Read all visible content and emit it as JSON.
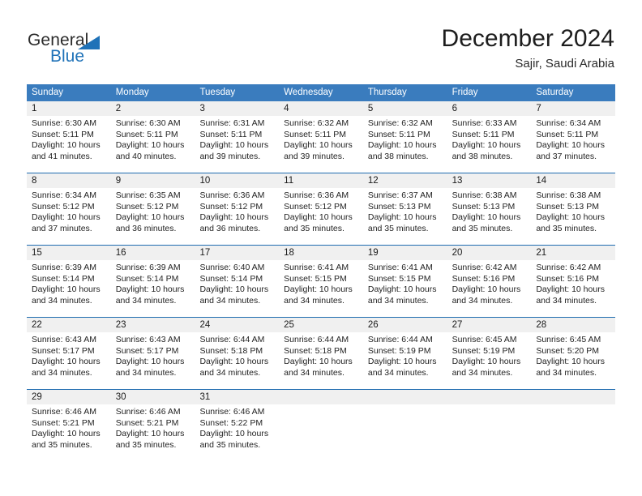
{
  "brand": {
    "name_part1": "General",
    "name_part2": "Blue"
  },
  "header": {
    "title": "December 2024",
    "subtitle": "Sajir, Saudi Arabia"
  },
  "weekdays": [
    "Sunday",
    "Monday",
    "Tuesday",
    "Wednesday",
    "Thursday",
    "Friday",
    "Saturday"
  ],
  "colors": {
    "header_blue": "#3a7cbe",
    "row_border_blue": "#1f6cb0",
    "day_band_gray": "#f0f0f0",
    "logo_blue": "#1f72b8",
    "text": "#1a1a1a"
  },
  "weeks": [
    [
      {
        "day": "1",
        "sunrise": "Sunrise: 6:30 AM",
        "sunset": "Sunset: 5:11 PM",
        "daylight": "Daylight: 10 hours and 41 minutes."
      },
      {
        "day": "2",
        "sunrise": "Sunrise: 6:30 AM",
        "sunset": "Sunset: 5:11 PM",
        "daylight": "Daylight: 10 hours and 40 minutes."
      },
      {
        "day": "3",
        "sunrise": "Sunrise: 6:31 AM",
        "sunset": "Sunset: 5:11 PM",
        "daylight": "Daylight: 10 hours and 39 minutes."
      },
      {
        "day": "4",
        "sunrise": "Sunrise: 6:32 AM",
        "sunset": "Sunset: 5:11 PM",
        "daylight": "Daylight: 10 hours and 39 minutes."
      },
      {
        "day": "5",
        "sunrise": "Sunrise: 6:32 AM",
        "sunset": "Sunset: 5:11 PM",
        "daylight": "Daylight: 10 hours and 38 minutes."
      },
      {
        "day": "6",
        "sunrise": "Sunrise: 6:33 AM",
        "sunset": "Sunset: 5:11 PM",
        "daylight": "Daylight: 10 hours and 38 minutes."
      },
      {
        "day": "7",
        "sunrise": "Sunrise: 6:34 AM",
        "sunset": "Sunset: 5:11 PM",
        "daylight": "Daylight: 10 hours and 37 minutes."
      }
    ],
    [
      {
        "day": "8",
        "sunrise": "Sunrise: 6:34 AM",
        "sunset": "Sunset: 5:12 PM",
        "daylight": "Daylight: 10 hours and 37 minutes."
      },
      {
        "day": "9",
        "sunrise": "Sunrise: 6:35 AM",
        "sunset": "Sunset: 5:12 PM",
        "daylight": "Daylight: 10 hours and 36 minutes."
      },
      {
        "day": "10",
        "sunrise": "Sunrise: 6:36 AM",
        "sunset": "Sunset: 5:12 PM",
        "daylight": "Daylight: 10 hours and 36 minutes."
      },
      {
        "day": "11",
        "sunrise": "Sunrise: 6:36 AM",
        "sunset": "Sunset: 5:12 PM",
        "daylight": "Daylight: 10 hours and 35 minutes."
      },
      {
        "day": "12",
        "sunrise": "Sunrise: 6:37 AM",
        "sunset": "Sunset: 5:13 PM",
        "daylight": "Daylight: 10 hours and 35 minutes."
      },
      {
        "day": "13",
        "sunrise": "Sunrise: 6:38 AM",
        "sunset": "Sunset: 5:13 PM",
        "daylight": "Daylight: 10 hours and 35 minutes."
      },
      {
        "day": "14",
        "sunrise": "Sunrise: 6:38 AM",
        "sunset": "Sunset: 5:13 PM",
        "daylight": "Daylight: 10 hours and 35 minutes."
      }
    ],
    [
      {
        "day": "15",
        "sunrise": "Sunrise: 6:39 AM",
        "sunset": "Sunset: 5:14 PM",
        "daylight": "Daylight: 10 hours and 34 minutes."
      },
      {
        "day": "16",
        "sunrise": "Sunrise: 6:39 AM",
        "sunset": "Sunset: 5:14 PM",
        "daylight": "Daylight: 10 hours and 34 minutes."
      },
      {
        "day": "17",
        "sunrise": "Sunrise: 6:40 AM",
        "sunset": "Sunset: 5:14 PM",
        "daylight": "Daylight: 10 hours and 34 minutes."
      },
      {
        "day": "18",
        "sunrise": "Sunrise: 6:41 AM",
        "sunset": "Sunset: 5:15 PM",
        "daylight": "Daylight: 10 hours and 34 minutes."
      },
      {
        "day": "19",
        "sunrise": "Sunrise: 6:41 AM",
        "sunset": "Sunset: 5:15 PM",
        "daylight": "Daylight: 10 hours and 34 minutes."
      },
      {
        "day": "20",
        "sunrise": "Sunrise: 6:42 AM",
        "sunset": "Sunset: 5:16 PM",
        "daylight": "Daylight: 10 hours and 34 minutes."
      },
      {
        "day": "21",
        "sunrise": "Sunrise: 6:42 AM",
        "sunset": "Sunset: 5:16 PM",
        "daylight": "Daylight: 10 hours and 34 minutes."
      }
    ],
    [
      {
        "day": "22",
        "sunrise": "Sunrise: 6:43 AM",
        "sunset": "Sunset: 5:17 PM",
        "daylight": "Daylight: 10 hours and 34 minutes."
      },
      {
        "day": "23",
        "sunrise": "Sunrise: 6:43 AM",
        "sunset": "Sunset: 5:17 PM",
        "daylight": "Daylight: 10 hours and 34 minutes."
      },
      {
        "day": "24",
        "sunrise": "Sunrise: 6:44 AM",
        "sunset": "Sunset: 5:18 PM",
        "daylight": "Daylight: 10 hours and 34 minutes."
      },
      {
        "day": "25",
        "sunrise": "Sunrise: 6:44 AM",
        "sunset": "Sunset: 5:18 PM",
        "daylight": "Daylight: 10 hours and 34 minutes."
      },
      {
        "day": "26",
        "sunrise": "Sunrise: 6:44 AM",
        "sunset": "Sunset: 5:19 PM",
        "daylight": "Daylight: 10 hours and 34 minutes."
      },
      {
        "day": "27",
        "sunrise": "Sunrise: 6:45 AM",
        "sunset": "Sunset: 5:19 PM",
        "daylight": "Daylight: 10 hours and 34 minutes."
      },
      {
        "day": "28",
        "sunrise": "Sunrise: 6:45 AM",
        "sunset": "Sunset: 5:20 PM",
        "daylight": "Daylight: 10 hours and 34 minutes."
      }
    ],
    [
      {
        "day": "29",
        "sunrise": "Sunrise: 6:46 AM",
        "sunset": "Sunset: 5:21 PM",
        "daylight": "Daylight: 10 hours and 35 minutes."
      },
      {
        "day": "30",
        "sunrise": "Sunrise: 6:46 AM",
        "sunset": "Sunset: 5:21 PM",
        "daylight": "Daylight: 10 hours and 35 minutes."
      },
      {
        "day": "31",
        "sunrise": "Sunrise: 6:46 AM",
        "sunset": "Sunset: 5:22 PM",
        "daylight": "Daylight: 10 hours and 35 minutes."
      },
      {
        "day": "",
        "sunrise": "",
        "sunset": "",
        "daylight": ""
      },
      {
        "day": "",
        "sunrise": "",
        "sunset": "",
        "daylight": ""
      },
      {
        "day": "",
        "sunrise": "",
        "sunset": "",
        "daylight": ""
      },
      {
        "day": "",
        "sunrise": "",
        "sunset": "",
        "daylight": ""
      }
    ]
  ]
}
